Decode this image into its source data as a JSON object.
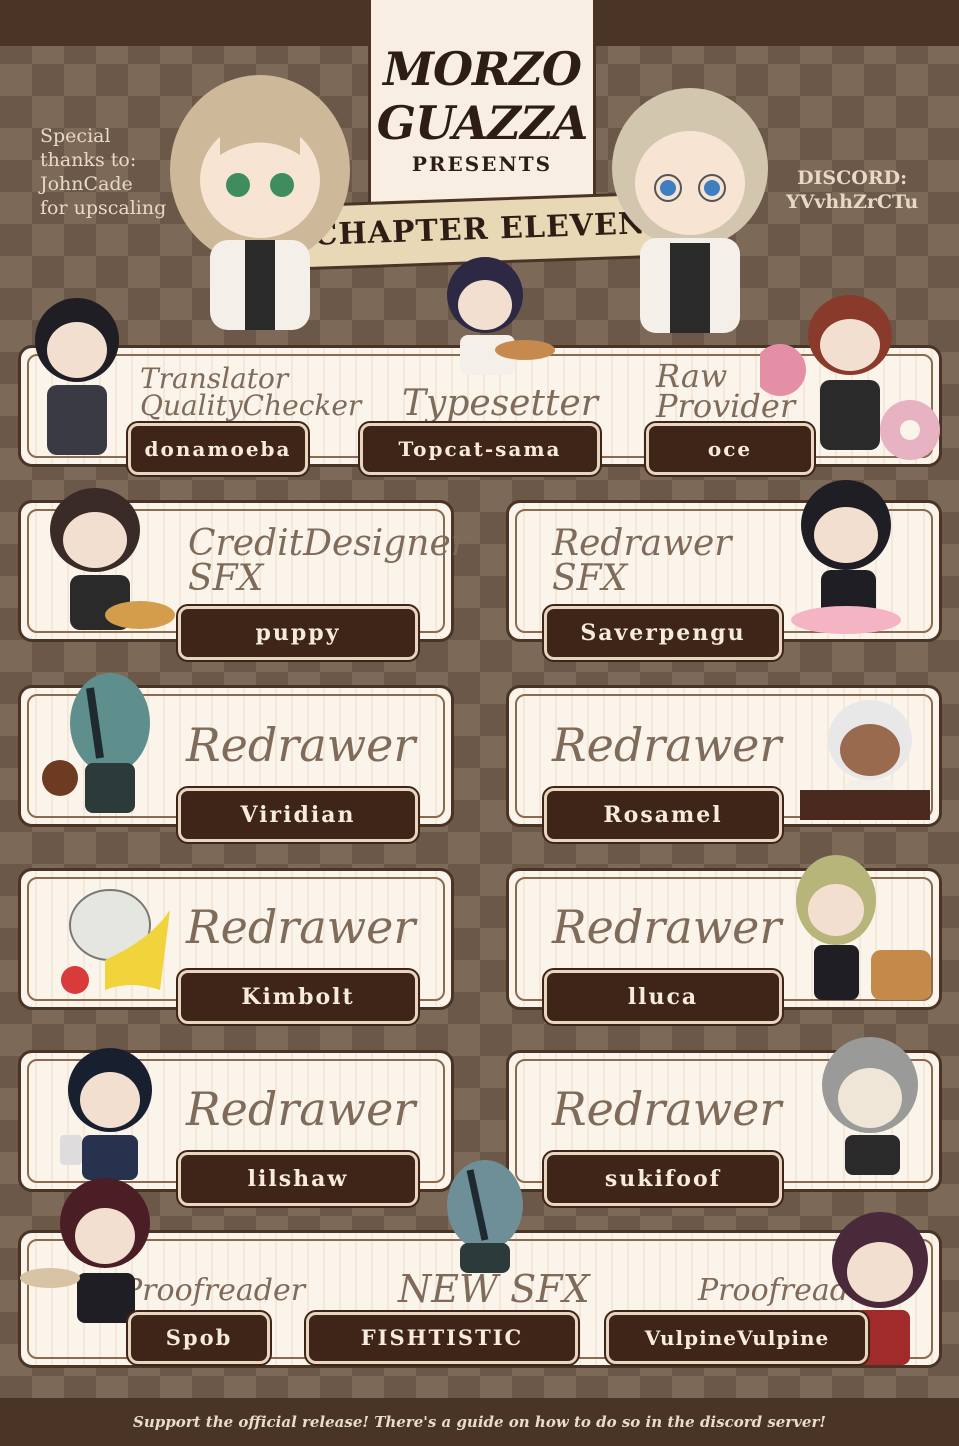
{
  "header": {
    "brand_line1": "MORZO",
    "brand_line2": "GUAZZA",
    "presents": "PRESENTS",
    "chapter": "CHAPTER ELEVEN"
  },
  "thanks": "Special thanks to: JohnCade for upscaling",
  "thanks_lines": [
    "Special",
    "thanks to:",
    "JohnCade",
    "for upscaling"
  ],
  "discord_label": "DISCORD:",
  "discord_code": "YVvhhZrCTu",
  "credits_top": [
    {
      "role": "Translator",
      "role2": "QualityChecker",
      "name": "donamoeba"
    },
    {
      "role": "Typesetter",
      "role2": "",
      "name": "Topcat-sama"
    },
    {
      "role": "Raw",
      "role2": "Provider",
      "name": "oce"
    }
  ],
  "credits_grid": [
    {
      "role": "CreditDesigner",
      "role2": "SFX",
      "name": "puppy"
    },
    {
      "role": "Redrawer",
      "role2": "SFX",
      "name": "Saverpengu"
    },
    {
      "role": "Redrawer",
      "role2": "",
      "name": "Viridian"
    },
    {
      "role": "Redrawer",
      "role2": "",
      "name": "Rosamel"
    },
    {
      "role": "Redrawer",
      "role2": "",
      "name": "Kimbolt"
    },
    {
      "role": "Redrawer",
      "role2": "",
      "name": "lluca"
    },
    {
      "role": "Redrawer",
      "role2": "",
      "name": "lilshaw"
    },
    {
      "role": "Redrawer",
      "role2": "",
      "name": "sukifoof"
    }
  ],
  "credits_bottom": [
    {
      "role": "Proofreader",
      "name": "Spob"
    },
    {
      "role": "NEW SFX",
      "name": "FISHTISTIC"
    },
    {
      "role": "Proofreader",
      "name": "VulpineVulpine"
    }
  ],
  "footer": "Support the official release! There's a guide on how to do so in the discord server!",
  "colors": {
    "dark_brown": "#4a3426",
    "cream": "#fbf4ea",
    "pill": "#3f2518"
  }
}
